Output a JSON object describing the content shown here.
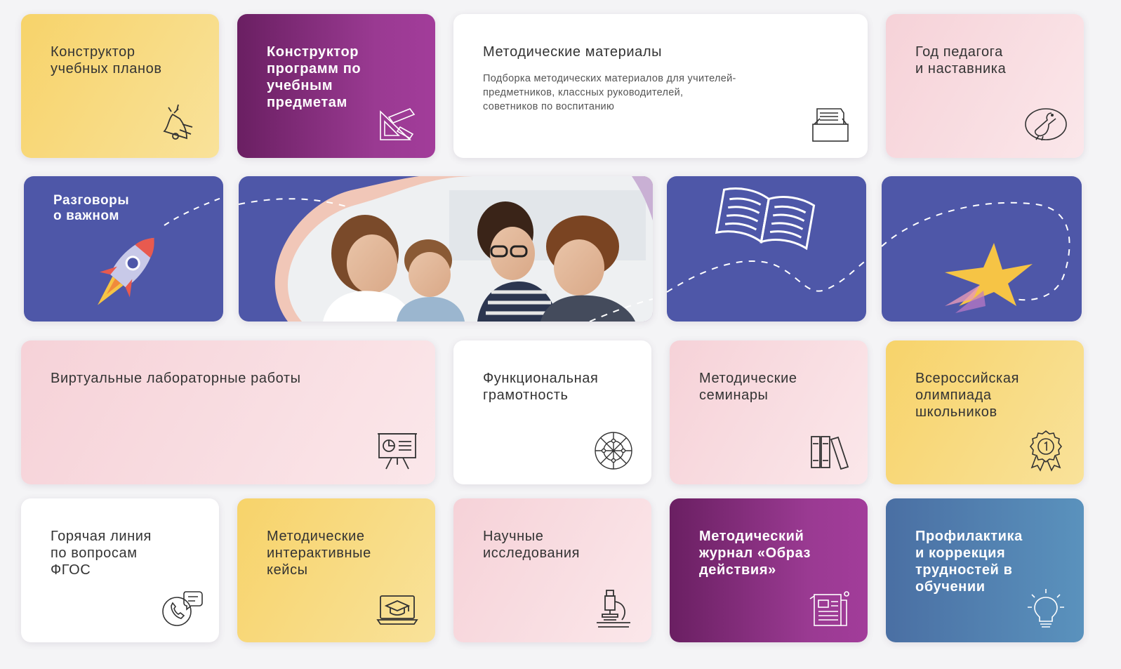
{
  "cards": {
    "curriculum_builder": {
      "title": "Конструктор\nучебных планов"
    },
    "program_builder": {
      "title": "Конструктор\nпрограмм по\nучебным\nпредметам"
    },
    "methodical_materials": {
      "title": "Методические материалы",
      "description": "Подборка методических материалов для учителей-\nпредметников, классных руководителей,\nсоветников по воспитанию"
    },
    "teacher_year": {
      "title": "Год педагога\nи наставника"
    },
    "important_talks": {
      "title": "Разговоры\nо важном"
    },
    "virtual_labs": {
      "title": "Виртуальные лабораторные работы"
    },
    "functional_literacy": {
      "title": "Функциональная\nграмотность"
    },
    "methodical_seminars": {
      "title": "Методические\nсеминары"
    },
    "olympiad": {
      "title": "Всероссийская\nолимпиада\nшкольников"
    },
    "fgos_hotline": {
      "title": "Горячая линия\nпо вопросам\nФГОС"
    },
    "interactive_cases": {
      "title": "Методические\nинтерактивные\nкейсы"
    },
    "research": {
      "title": "Научные\nисследования"
    },
    "journal": {
      "title": "Методический\nжурнал «Образ\nдействия»"
    },
    "prevention": {
      "title": "Профилактика\nи коррекция\nтрудностей в\nобучении"
    }
  },
  "icons": {
    "bell": "bell-icon",
    "drafting_tools": "drafting-tools-icon",
    "file_tray": "file-tray-icon",
    "pelican": "pelican-icon",
    "rocket": "rocket-icon",
    "book": "open-book-icon",
    "star": "star-icon",
    "presentation": "presentation-board-icon",
    "network": "network-sphere-icon",
    "books": "books-icon",
    "medal": "medal-icon",
    "phone": "phone-chat-icon",
    "laptop": "laptop-graduation-icon",
    "microscope": "microscope-icon",
    "journal": "journal-icon",
    "bulb": "lightbulb-icon"
  },
  "colors": {
    "yellow": "#f7d36a",
    "purple": "#8a2f80",
    "pink": "#f6d2d8",
    "blue": "#4e57a8",
    "steel": "#4a6fa3",
    "accent_orange": "#f0a04b"
  }
}
